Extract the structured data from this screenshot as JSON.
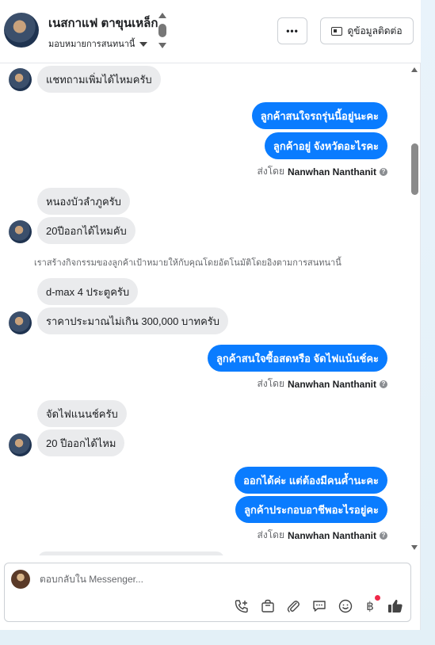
{
  "header": {
    "name": "เนสกาแฟ ตาขุนเหล็ก",
    "assign_label": "มอบหมายการสนทนานี้",
    "more_label": "•••",
    "contact_label": "ดูข้อมูลติดต่อ"
  },
  "messages": [
    {
      "dir": "in",
      "text": "แชทถามเพิ่มได้ไหมครับ"
    },
    {
      "dir": "out",
      "text": "ลูกค้าสนใจรถรุ่นนี้อยู่นะคะ"
    },
    {
      "dir": "out",
      "text": "ลูกค้าอยู่ จังหวัดอะไรคะ"
    },
    {
      "dir": "in",
      "text": "หนองบัวลำภูครับ"
    },
    {
      "dir": "in",
      "text": "20ปีออกได้ไหมคับ"
    },
    {
      "dir": "in",
      "text": "d-max 4 ประตูครับ"
    },
    {
      "dir": "in",
      "text": "ราคาประมาณไม่เกิน 300,000 บาทครับ"
    },
    {
      "dir": "out",
      "text": "ลูกค้าสนใจซื้อสดหรือ จัดไฟแน้นช์คะ"
    },
    {
      "dir": "in",
      "text": "จัดไฟแนนช์ครับ"
    },
    {
      "dir": "in",
      "text": "20 ปีออกได้ไหม"
    },
    {
      "dir": "out",
      "text": "ออกได้ค่ะ แต่ต้องมีคนค้ำนะคะ"
    },
    {
      "dir": "out",
      "text": "ลูกค้าประกอบอาชีพอะไรอยู่คะ"
    }
  ],
  "sent_by": {
    "prefix": "ส่งโดย",
    "name": "Nanwhan Nanthanit"
  },
  "system_note": "เราสร้างกิจกรรมของลูกค้าเป้าหมายให้กับคุณโดยอัตโนมัติโดยอิงตามการสนทนานี้",
  "composer": {
    "placeholder": "ตอบกลับใน Messenger...",
    "icons": [
      "call-add-icon",
      "shopping-bag-icon",
      "paperclip-icon",
      "chat-bubble-icon",
      "emoji-icon",
      "baht-icon",
      "thumbs-up-icon"
    ]
  },
  "colors": {
    "accent": "#0a7cff",
    "incoming": "#eaebed",
    "notification": "#f02849"
  }
}
